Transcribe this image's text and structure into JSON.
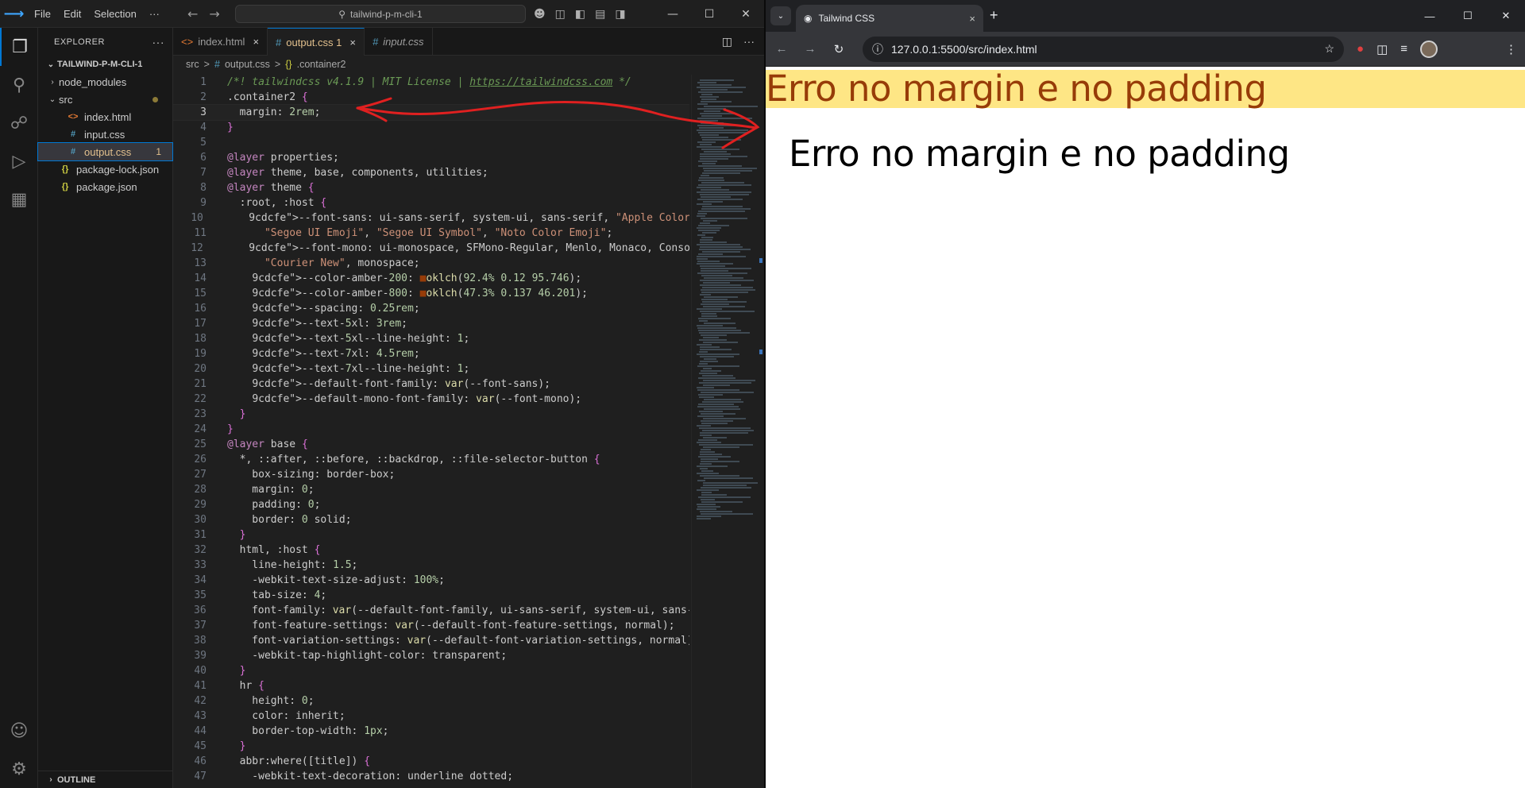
{
  "vscode": {
    "menu": [
      "File",
      "Edit",
      "Selection",
      "···"
    ],
    "command_center": "tailwind-p-m-cli-1",
    "explorer_title": "EXPLORER",
    "explorer_more": "···",
    "project_folder": "TAILWIND-P-M-CLI-1",
    "tree": [
      {
        "label": "node_modules",
        "depth": 1,
        "chevron": "›",
        "icon": ""
      },
      {
        "label": "src",
        "depth": 1,
        "chevron": "⌄",
        "icon": ""
      },
      {
        "label": "index.html",
        "depth": 2,
        "chevron": "",
        "icon": "<>"
      },
      {
        "label": "input.css",
        "depth": 2,
        "chevron": "",
        "icon": "#"
      },
      {
        "label": "output.css",
        "depth": 2,
        "chevron": "",
        "icon": "#",
        "badge": "1"
      },
      {
        "label": "package-lock.json",
        "depth": 1,
        "chevron": "",
        "icon": "{}"
      },
      {
        "label": "package.json",
        "depth": 1,
        "chevron": "",
        "icon": "{}"
      }
    ],
    "outline_label": "OUTLINE",
    "tabs": [
      {
        "label": "index.html",
        "icon": "<>",
        "close": "×"
      },
      {
        "label": "output.css 1",
        "icon": "#",
        "close": "×"
      },
      {
        "label": "input.css",
        "icon": "#",
        "close": ""
      }
    ],
    "breadcrumbs": [
      "src",
      ">",
      "#",
      "output.css",
      ">",
      "{}",
      ".container2"
    ],
    "code_lines": [
      "/*! tailwindcss v4.1.9 | MIT License | https://tailwindcss.com */",
      ".container2 {",
      "  margin: 2rem;",
      "}",
      "",
      "@layer properties;",
      "@layer theme, base, components, utilities;",
      "@layer theme {",
      "  :root, :host {",
      "    --font-sans: ui-sans-serif, system-ui, sans-serif, \"Apple Color Emoji\",",
      "      \"Segoe UI Emoji\", \"Segoe UI Symbol\", \"Noto Color Emoji\";",
      "    --font-mono: ui-monospace, SFMono-Regular, Menlo, Monaco, Consolas, \"Li",
      "      \"Courier New\", monospace;",
      "    --color-amber-200: ■oklch(92.4% 0.12 95.746);",
      "    --color-amber-800: ■oklch(47.3% 0.137 46.201);",
      "    --spacing: 0.25rem;",
      "    --text-5xl: 3rem;",
      "    --text-5xl--line-height: 1;",
      "    --text-7xl: 4.5rem;",
      "    --text-7xl--line-height: 1;",
      "    --default-font-family: var(--font-sans);",
      "    --default-mono-font-family: var(--font-mono);",
      "  }",
      "}",
      "@layer base {",
      "  *, ::after, ::before, ::backdrop, ::file-selector-button {",
      "    box-sizing: border-box;",
      "    margin: 0;",
      "    padding: 0;",
      "    border: 0 solid;",
      "  }",
      "  html, :host {",
      "    line-height: 1.5;",
      "    -webkit-text-size-adjust: 100%;",
      "    tab-size: 4;",
      "    font-family: var(--default-font-family, ui-sans-serif, system-ui, sans-",
      "    font-feature-settings: var(--default-font-feature-settings, normal);",
      "    font-variation-settings: var(--default-font-variation-settings, normal)",
      "    -webkit-tap-highlight-color: transparent;",
      "  }",
      "  hr {",
      "    height: 0;",
      "    color: inherit;",
      "    border-top-width: 1px;",
      "  }",
      "  abbr:where([title]) {",
      "    -webkit-text-decoration: underline dotted;"
    ],
    "current_line": 3,
    "annotation_color": "#e02020"
  },
  "chrome": {
    "tab_title": "Tailwind CSS",
    "tab_close": "×",
    "new_tab": "+",
    "url": "127.0.0.1:5500/src/index.html",
    "page": {
      "heading_amber": "Erro no margin e no padding",
      "heading_plain": "Erro no margin e no padding"
    },
    "colors": {
      "amber_bg": "#fee685",
      "amber_text": "#973c08"
    }
  }
}
